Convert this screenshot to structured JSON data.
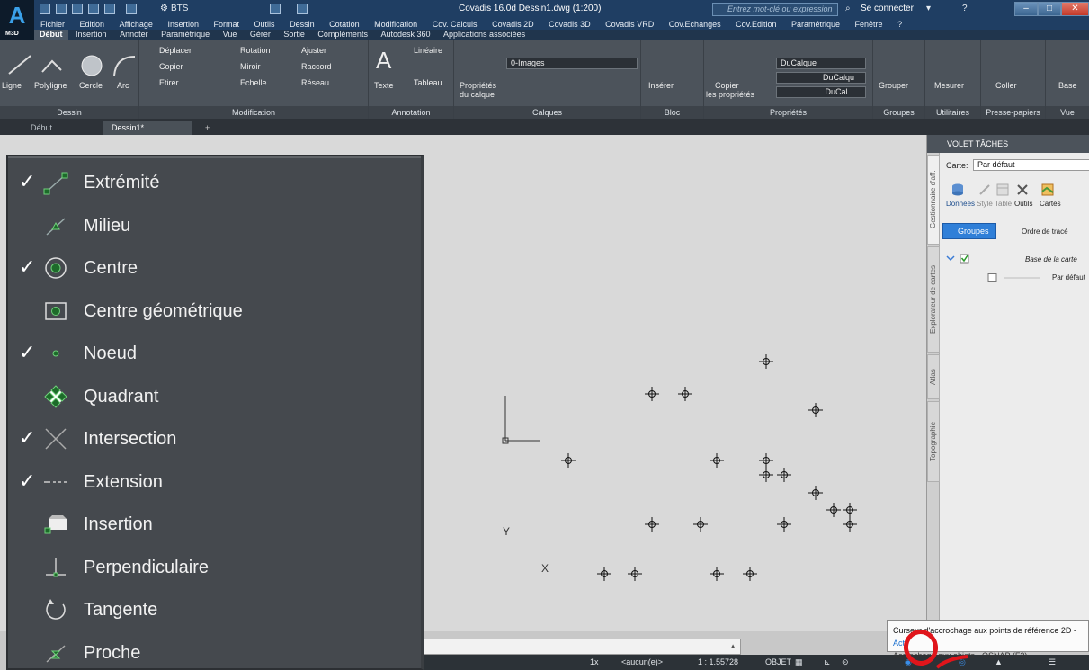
{
  "titlebar": {
    "logo": "A",
    "logo_sub": "M3D",
    "workspace": "BTS",
    "document": "Covadis 16.0d   Dessin1.dwg (1:200)",
    "search_placeholder": "Entrez mot-clé ou expression",
    "signin": "Se connecter"
  },
  "menubar": [
    "Fichier",
    "Edition",
    "Affichage",
    "Insertion",
    "Format",
    "Outils",
    "Dessin",
    "Cotation",
    "Modification",
    "Cov. Calculs",
    "Covadis 2D",
    "Covadis 3D",
    "Covadis VRD",
    "Cov.Echanges",
    "Cov.Edition",
    "Paramétrique",
    "Fenêtre",
    "?"
  ],
  "ribbon_tabs": [
    "Début",
    "Insertion",
    "Annoter",
    "Paramétrique",
    "Vue",
    "Gérer",
    "Sortie",
    "Compléments",
    "Autodesk 360",
    "Applications associées"
  ],
  "ribbon": {
    "dessin": {
      "title": "Dessin",
      "ligne": "Ligne",
      "polyligne": "Polyligne",
      "cercle": "Cercle",
      "arc": "Arc"
    },
    "modification": {
      "title": "Modification",
      "deplacer": "Déplacer",
      "rotation": "Rotation",
      "ajuster": "Ajuster",
      "copier": "Copier",
      "miroir": "Miroir",
      "raccord": "Raccord",
      "etirer": "Etirer",
      "echelle": "Echelle",
      "reseau": "Réseau"
    },
    "annotation": {
      "title": "Annotation",
      "texte": "Texte",
      "lineaire": "Linéaire",
      "tableau": "Tableau"
    },
    "calques": {
      "title": "Calques",
      "proprietes": "Propriétés",
      "du_calque": "du calque",
      "layer": "0-Images"
    },
    "bloc": {
      "title": "Bloc",
      "inserer": "Insérer"
    },
    "proprietes": {
      "title": "Propriétés",
      "copier": "Copier",
      "les_proprietes": "les propriétés",
      "ducalque": "DuCalque",
      "ducalqu": "DuCalqu",
      "ducal": "DuCal..."
    },
    "groupes": {
      "title": "Groupes",
      "grouper": "Grouper"
    },
    "utilitaires": {
      "title": "Utilitaires",
      "mesurer": "Mesurer"
    },
    "presse_papiers": {
      "title": "Presse-papiers",
      "coller": "Coller"
    },
    "vue": {
      "title": "Vue",
      "base": "Base"
    }
  },
  "doc_tabs": [
    "Début",
    "Dessin1*"
  ],
  "osnap_menu": [
    {
      "label": "Extrémité",
      "checked": true,
      "icon": "endpoint-icon"
    },
    {
      "label": "Milieu",
      "checked": false,
      "icon": "midpoint-icon"
    },
    {
      "label": "Centre",
      "checked": true,
      "icon": "center-icon"
    },
    {
      "label": "Centre géométrique",
      "checked": false,
      "icon": "geometric-center-icon"
    },
    {
      "label": "Noeud",
      "checked": true,
      "icon": "node-icon"
    },
    {
      "label": "Quadrant",
      "checked": false,
      "icon": "quadrant-icon"
    },
    {
      "label": "Intersection",
      "checked": true,
      "icon": "intersection-icon"
    },
    {
      "label": "Extension",
      "checked": true,
      "icon": "extension-icon"
    },
    {
      "label": "Insertion",
      "checked": false,
      "icon": "insertion-icon"
    },
    {
      "label": "Perpendiculaire",
      "checked": false,
      "icon": "perpendicular-icon"
    },
    {
      "label": "Tangente",
      "checked": false,
      "icon": "tangent-icon"
    },
    {
      "label": "Proche",
      "checked": false,
      "icon": "nearest-icon"
    }
  ],
  "check_glyph": "✓",
  "ucs": {
    "x": "X",
    "y": "Y"
  },
  "taskpane": {
    "header": "VOLET TÂCHES",
    "carte_label": "Carte:",
    "carte_value": "Par défaut",
    "tools": [
      "Données",
      "Style",
      "Table",
      "Outils",
      "Cartes"
    ],
    "groupes": "Groupes",
    "ordre": "Ordre de tracé",
    "base": "Base de la carte",
    "par_defaut": "Par défaut",
    "vtabs": [
      "Gestionnaire d'aff.",
      "Explorateur de cartes",
      "Atlas",
      "Topographie"
    ]
  },
  "statusbar": {
    "scale_aucun": "<aucun(e)>",
    "ratio": "1 : 1.55728",
    "objet": "OBJET",
    "zoom": "1x"
  },
  "tooltip": {
    "title": "Curseur d'accrochage aux points de référence 2D - ",
    "link": "Acti",
    "body": "Accrochage aux objets - OSNAP (F3)"
  }
}
